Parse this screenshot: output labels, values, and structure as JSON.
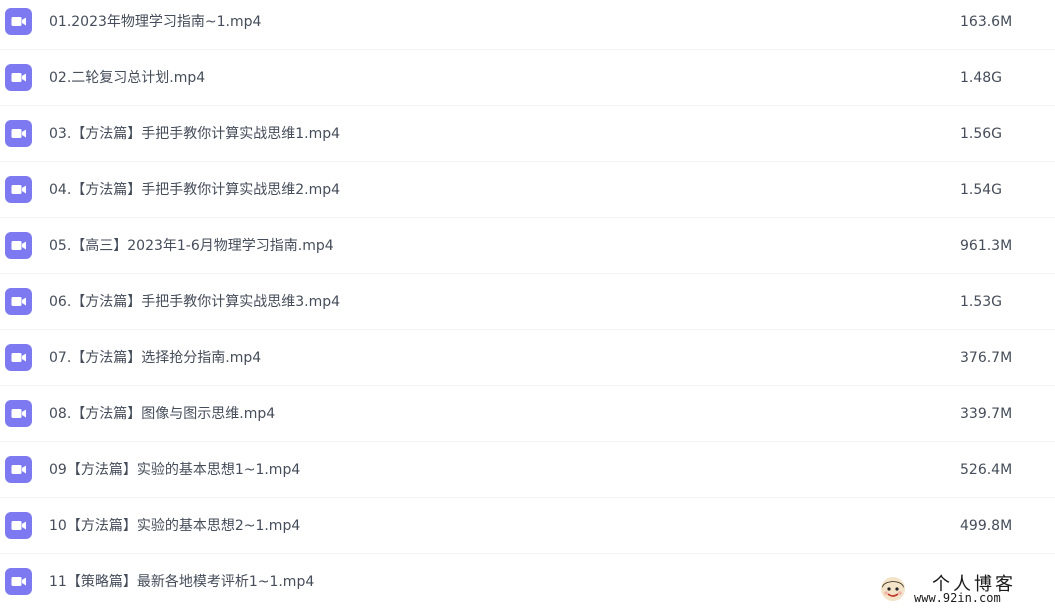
{
  "files": [
    {
      "name": "01.2023年物理学习指南~1.mp4",
      "size": "163.6M",
      "icon": "video-icon"
    },
    {
      "name": "02.二轮复习总计划.mp4",
      "size": "1.48G",
      "icon": "video-icon"
    },
    {
      "name": "03.【方法篇】手把手教你计算实战思维1.mp4",
      "size": "1.56G",
      "icon": "video-icon"
    },
    {
      "name": "04.【方法篇】手把手教你计算实战思维2.mp4",
      "size": "1.54G",
      "icon": "video-icon"
    },
    {
      "name": "05.【高三】2023年1-6月物理学习指南.mp4",
      "size": "961.3M",
      "icon": "video-icon"
    },
    {
      "name": "06.【方法篇】手把手教你计算实战思维3.mp4",
      "size": "1.53G",
      "icon": "video-icon"
    },
    {
      "name": "07.【方法篇】选择抢分指南.mp4",
      "size": "376.7M",
      "icon": "video-icon"
    },
    {
      "name": "08.【方法篇】图像与图示思维.mp4",
      "size": "339.7M",
      "icon": "video-icon"
    },
    {
      "name": "09【方法篇】实验的基本思想1~1.mp4",
      "size": "526.4M",
      "icon": "video-icon"
    },
    {
      "name": "10【方法篇】实验的基本思想2~1.mp4",
      "size": "499.8M",
      "icon": "video-icon"
    },
    {
      "name": "11【策略篇】最新各地模考评析1~1.mp4",
      "size": "",
      "icon": "video-icon"
    }
  ],
  "watermark": {
    "title": "个人博客",
    "url": "www.92in.com",
    "icon": "avatar-icon"
  },
  "colors": {
    "icon_bg": "#7d79f1",
    "text": "#454d5a",
    "divider": "#f1f2f4"
  }
}
